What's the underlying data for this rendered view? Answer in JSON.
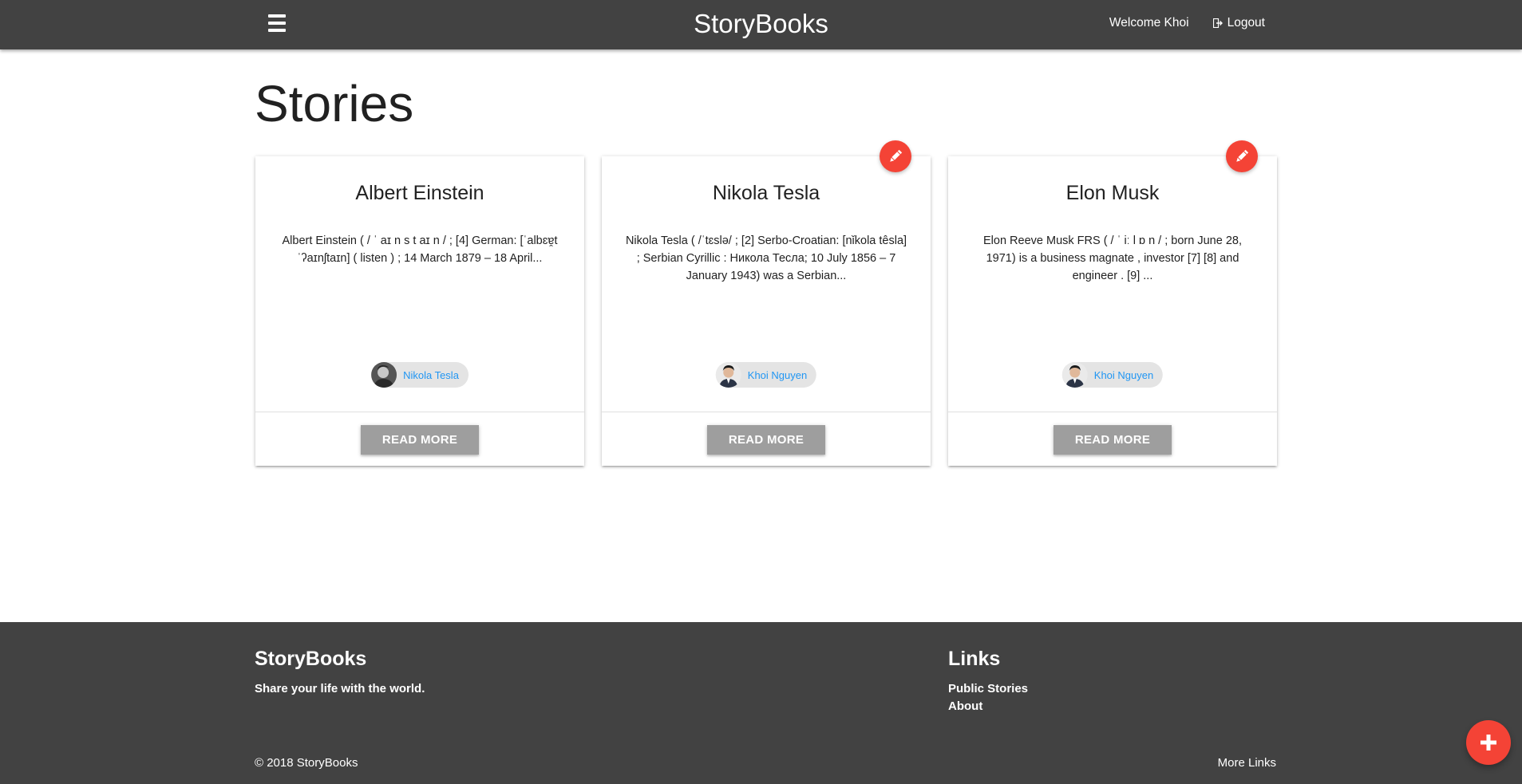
{
  "nav": {
    "brand": "StoryBooks",
    "welcome": "Welcome Khoi",
    "logout": "Logout"
  },
  "main": {
    "title": "Stories",
    "stories": [
      {
        "title": "Albert Einstein",
        "excerpt": "Albert Einstein ( / ˈ aɪ n s t aɪ n / ; [4] German: [ˈalbɛɐ̯t ˈʔaɪnʃtaɪn] ( listen ) ; 14 March 1879 – 18 April...",
        "author": "Nikola Tesla",
        "read_more": "READ MORE",
        "editable": false
      },
      {
        "title": "Nikola Tesla",
        "excerpt": "Nikola Tesla ( /ˈtɛslə/ ; [2] Serbo-Croatian: [nǐkola têsla] ; Serbian Cyrillic : Никола Тесла; 10 July 1856 – 7 January 1943) was a Serbian...",
        "author": "Khoi Nguyen",
        "read_more": "READ MORE",
        "editable": true
      },
      {
        "title": "Elon Musk",
        "excerpt": "Elon Reeve Musk FRS ( / ˈ iː l ɒ n / ; born June 28, 1971) is a business magnate , investor [7] [8] and engineer . [9] ...",
        "author": "Khoi Nguyen",
        "read_more": "READ MORE",
        "editable": true
      }
    ]
  },
  "footer": {
    "title": "StoryBooks",
    "tagline": "Share your life with the world.",
    "links_title": "Links",
    "links": [
      "Public Stories",
      "About"
    ],
    "copyright": "© 2018 StoryBooks",
    "more_links": "More Links"
  },
  "colors": {
    "nav": "#424242",
    "accent": "#f44336",
    "link": "#2196f3",
    "button": "#9e9e9e"
  },
  "icons": {
    "menu": "hamburger-icon",
    "logout": "sign-out-icon",
    "edit": "pencil-icon",
    "add": "plus-icon"
  }
}
